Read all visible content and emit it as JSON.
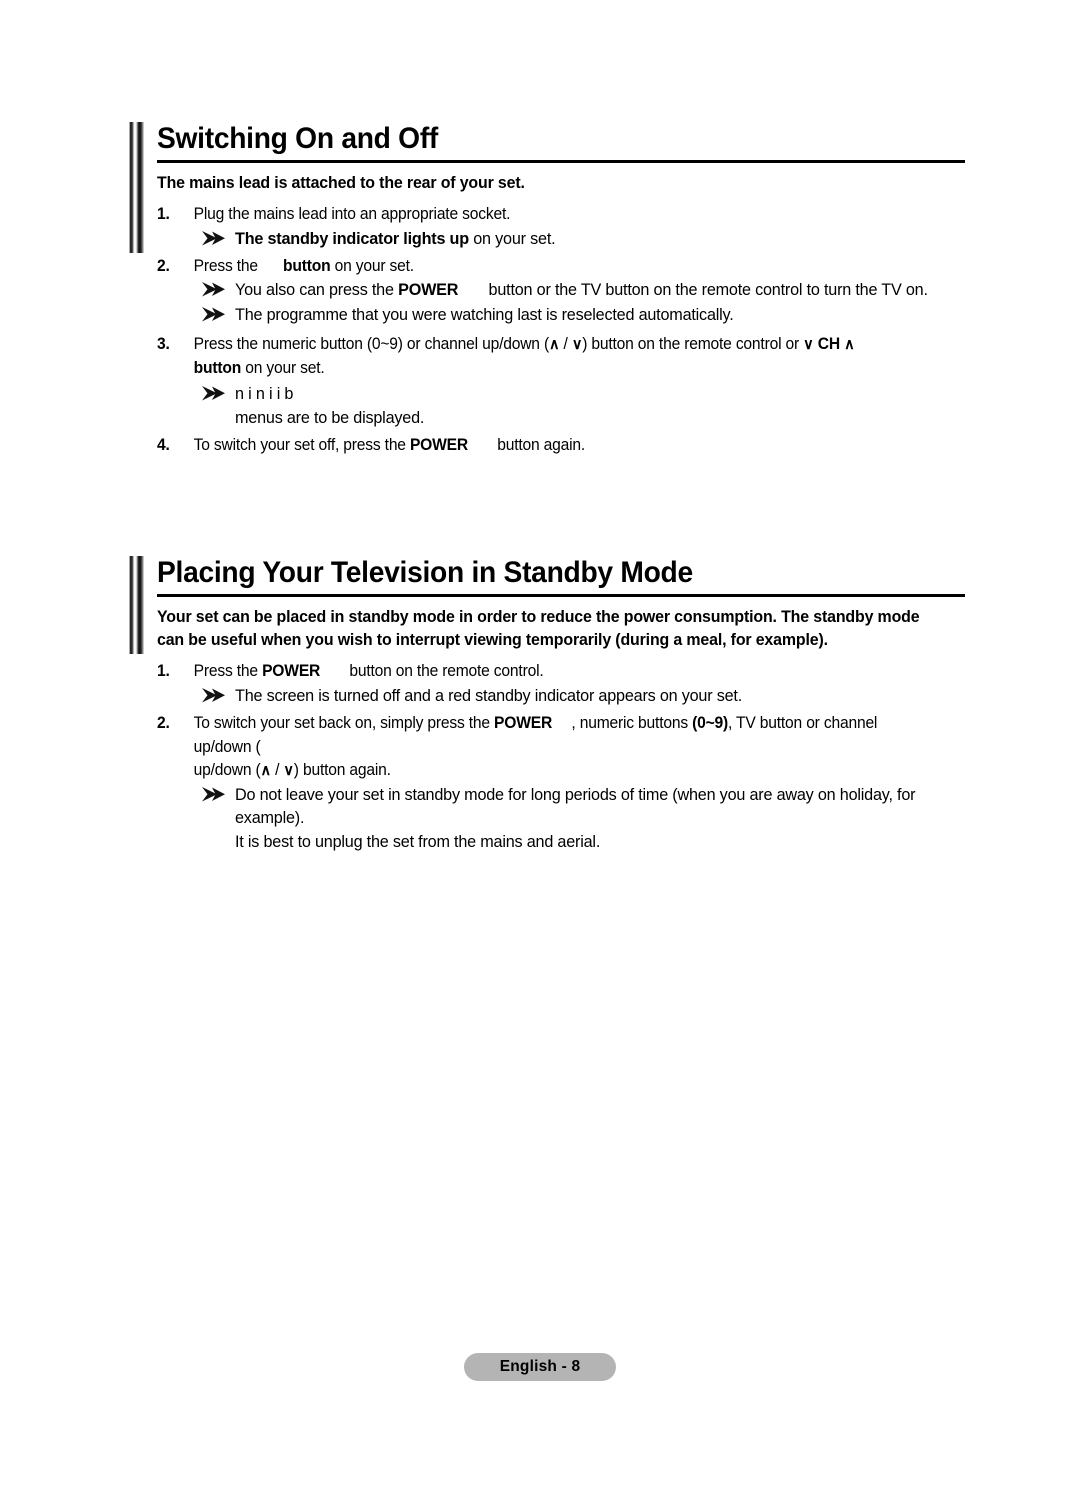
{
  "document": {
    "page_footer_label": "English - 8"
  },
  "sections": [
    {
      "heading": "Switching On and Off",
      "lede": "The mains lead is attached to the rear of your set.",
      "steps": [
        {
          "number": "1.",
          "text": "Plug the mains lead into an appropriate socket.",
          "notes": [
            {
              "bold": "The standby indicator lights up",
              "rest": " on your set."
            }
          ]
        },
        {
          "number": "2.",
          "pre": "Press the",
          "bold": "button",
          "post": " on your set.",
          "notes": [
            {
              "pre": "You also can press the ",
              "bold": "POWER",
              "post": " button or the TV button on the remote control to turn the TV on.",
              "tv_bold": "TV"
            },
            {
              "plain": "The programme that you were watching last is reselected automatically."
            }
          ]
        },
        {
          "number": "3.",
          "pre": "Press the numeric button (0~9) or channel up/down (",
          "mid": ") button on the remote control or",
          "ch_label": "CH",
          "bold_tail": "button",
          "post_tail": " on your set.",
          "corrupted_glyphs": [
            "n",
            "i",
            "n",
            "i",
            "i",
            "b"
          ],
          "trailing_text": "menus are to be displayed."
        },
        {
          "number": "4.",
          "pre": "To switch your set off, press the ",
          "bold": "POWER",
          "post": " button again."
        }
      ]
    },
    {
      "heading": "Placing Your Television in Standby Mode",
      "lede": "Your set can be placed in standby mode in order to reduce the power consumption. The standby mode can be useful when you wish to interrupt viewing temporarily (during a meal, for example).",
      "steps": [
        {
          "number": "1.",
          "pre": "Press the ",
          "bold": "POWER",
          "post": " button on the remote control.",
          "notes": [
            {
              "plain": "The screen is turned off and a red standby indicator appears on your set."
            }
          ]
        },
        {
          "number": "2.",
          "pre": "To switch your set back on, simply press the ",
          "bold": "POWER",
          "mid": ", numeric buttons ",
          "bold2": "(0~9)",
          "post": ", TV button or channel up/down (",
          "tail": ") button again.",
          "tv_bold": "TV",
          "notes": [
            {
              "plain": "Do not leave your set in standby mode for long periods of time (when you are away on holiday, for example)."
            },
            {
              "plain": "It is best to unplug the set from the mains and aerial."
            }
          ]
        }
      ]
    }
  ],
  "symbols": {
    "chevron_up": "∧",
    "chevron_down": "∨",
    "arrow_bullet": "arrow-bullet-icon"
  }
}
